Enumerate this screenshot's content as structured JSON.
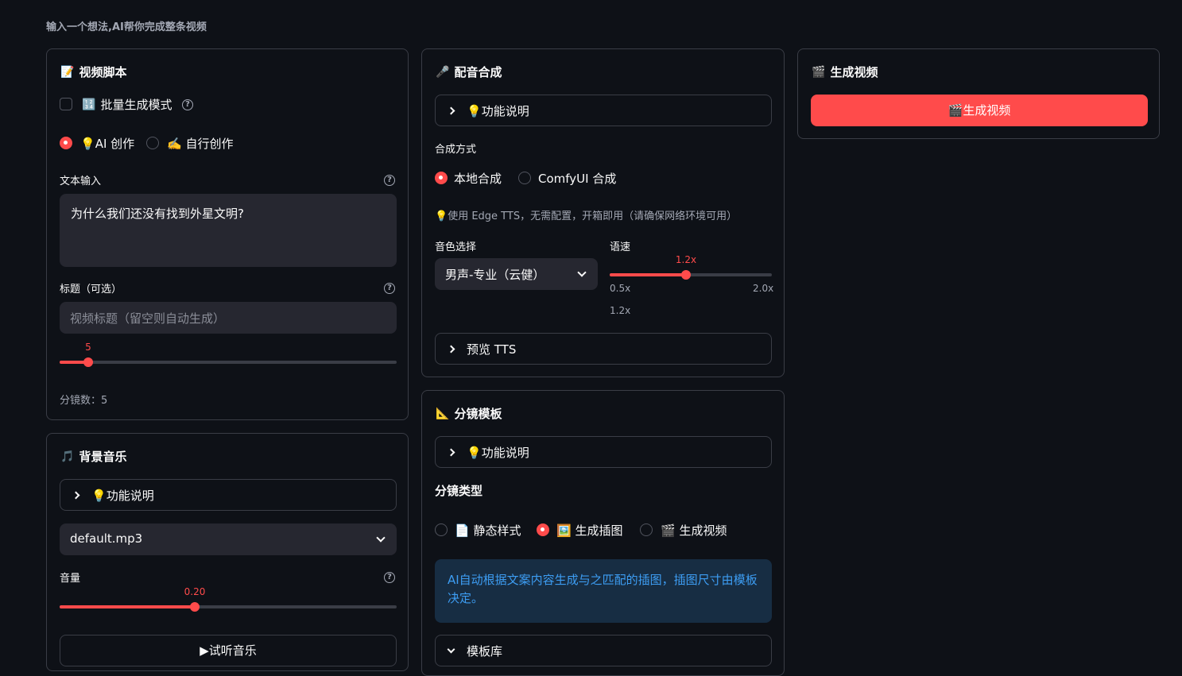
{
  "subtitle": "输入一个想法,AI帮你完成整条视频",
  "script_panel": {
    "title": "视频脚本",
    "title_icon": "📝",
    "batch_mode_label": "批量生成模式",
    "batch_icon": "🔢",
    "batch_mode_checked": false,
    "modes": [
      {
        "icon": "💡",
        "label": "AI 创作",
        "selected": true
      },
      {
        "icon": "✍️",
        "label": "自行创作",
        "selected": false
      }
    ],
    "text_input_label": "文本输入",
    "text_input_value": "为什么我们还没有找到外星文明?",
    "title_label": "标题（可选）",
    "title_placeholder": "视频标题（留空则自动生成）",
    "scenes_slider_value": "5",
    "scenes_slider_fraction": 0.087,
    "scenes_count_text": "分镜数：5"
  },
  "music_panel": {
    "title": "背景音乐",
    "title_icon": "🎵",
    "help_expander": "功能说明",
    "help_icon": "💡",
    "music_select": "default.mp3",
    "volume_label": "音量",
    "volume_value": "0.20",
    "volume_fraction": 0.4,
    "preview_button": "▶试听音乐"
  },
  "tts_panel": {
    "title": "配音合成",
    "title_icon": "🎤",
    "help_expander": "功能说明",
    "help_icon": "💡",
    "method_label": "合成方式",
    "methods": [
      {
        "label": "本地合成",
        "selected": true
      },
      {
        "label": "ComfyUI 合成",
        "selected": false
      }
    ],
    "tip_icon": "💡",
    "tip_text": "使用 Edge TTS，无需配置，开箱即用（请确保网络环境可用）",
    "voice_label": "音色选择",
    "voice_value": "男声-专业（云健）",
    "speed_label": "语速",
    "speed_value": "1.2x",
    "speed_fraction": 0.47,
    "speed_min": "0.5x",
    "speed_max": "2.0x",
    "speed_current_text": "1.2x",
    "preview_expander": "预览 TTS"
  },
  "storyboard_panel": {
    "title": "分镜模板",
    "title_icon": "📐",
    "help_expander": "功能说明",
    "help_icon": "💡",
    "type_label": "分镜类型",
    "types": [
      {
        "icon": "📄",
        "label": "静态样式",
        "selected": false
      },
      {
        "icon": "🖼️",
        "label": "生成插图",
        "selected": true
      },
      {
        "icon": "🎬",
        "label": "生成视频",
        "selected": false
      }
    ],
    "info_text": "AI自动根据文案内容生成与之匹配的插图，插图尺寸由模板决定。",
    "template_expander": "模板库"
  },
  "generate_panel": {
    "title": "生成视频",
    "title_icon": "🎬",
    "button_icon": "🎬",
    "button_label": "生成视频"
  },
  "colors": {
    "accent": "#ff4b4b",
    "background": "#0e1117",
    "input_bg": "#262730",
    "info_bg": "#172d43",
    "info_text": "#3d9df3"
  }
}
